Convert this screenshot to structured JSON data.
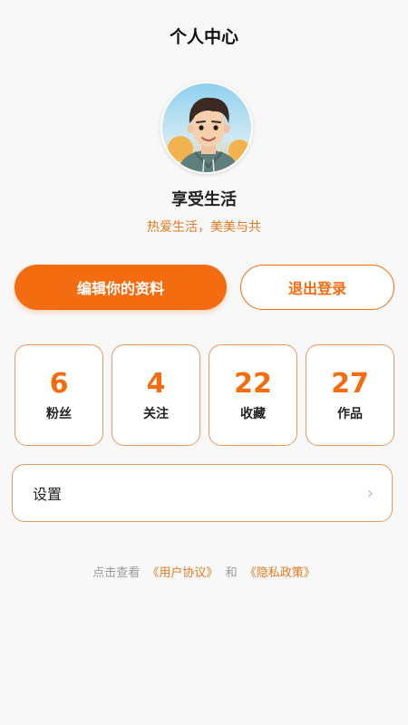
{
  "header": {
    "title": "个人中心"
  },
  "profile": {
    "username": "享受生活",
    "bio": "热爱生活，美美与共"
  },
  "actions": {
    "edit_label": "编辑你的资料",
    "logout_label": "退出登录"
  },
  "stats": [
    {
      "value": "6",
      "label": "粉丝"
    },
    {
      "value": "4",
      "label": "关注"
    },
    {
      "value": "22",
      "label": "收藏"
    },
    {
      "value": "27",
      "label": "作品"
    }
  ],
  "settings": {
    "label": "设置",
    "icon": "chevron-right-icon"
  },
  "agreement": {
    "prefix": "点击查看",
    "user_agreement": "《用户协议》",
    "conjunction": "和",
    "privacy_policy": "《隐私政策》"
  },
  "colors": {
    "accent": "#f36c0f",
    "accent_text": "#e07a1f",
    "card_border": "#e69a5e",
    "background": "#f8f8f8"
  }
}
